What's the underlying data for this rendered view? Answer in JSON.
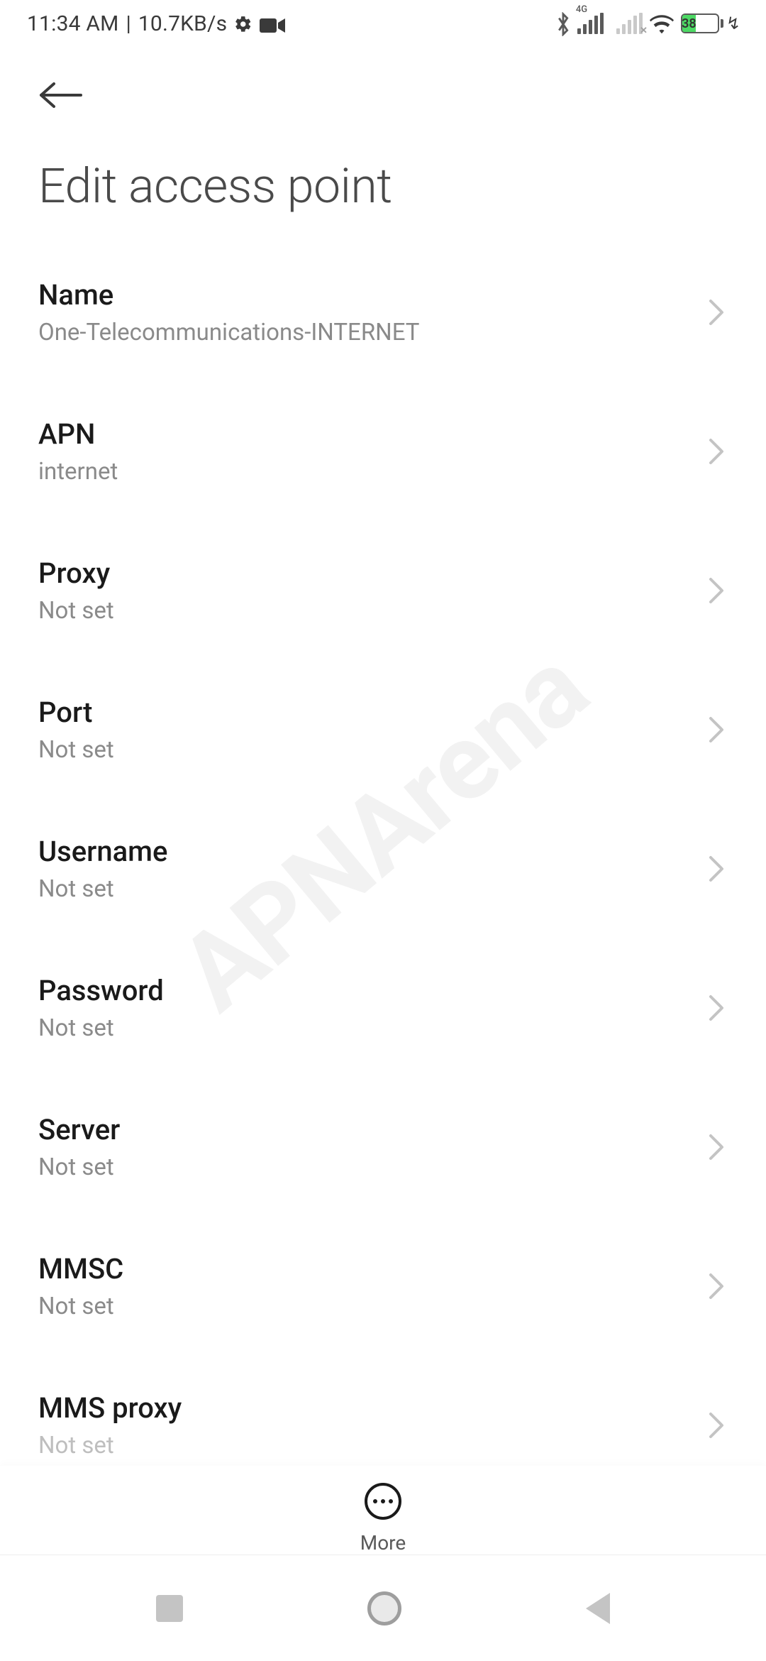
{
  "status": {
    "time": "11:34 AM",
    "separator": "|",
    "data_rate": "10.7KB/s",
    "network_label": "4G",
    "battery_pct": "38"
  },
  "page": {
    "title": "Edit access point"
  },
  "settings": [
    {
      "label": "Name",
      "value": "One-Telecommunications-INTERNET"
    },
    {
      "label": "APN",
      "value": "internet"
    },
    {
      "label": "Proxy",
      "value": "Not set"
    },
    {
      "label": "Port",
      "value": "Not set"
    },
    {
      "label": "Username",
      "value": "Not set"
    },
    {
      "label": "Password",
      "value": "Not set"
    },
    {
      "label": "Server",
      "value": "Not set"
    },
    {
      "label": "MMSC",
      "value": "Not set"
    },
    {
      "label": "MMS proxy",
      "value": "Not set"
    }
  ],
  "more": {
    "label": "More"
  },
  "watermark": "APNArena"
}
